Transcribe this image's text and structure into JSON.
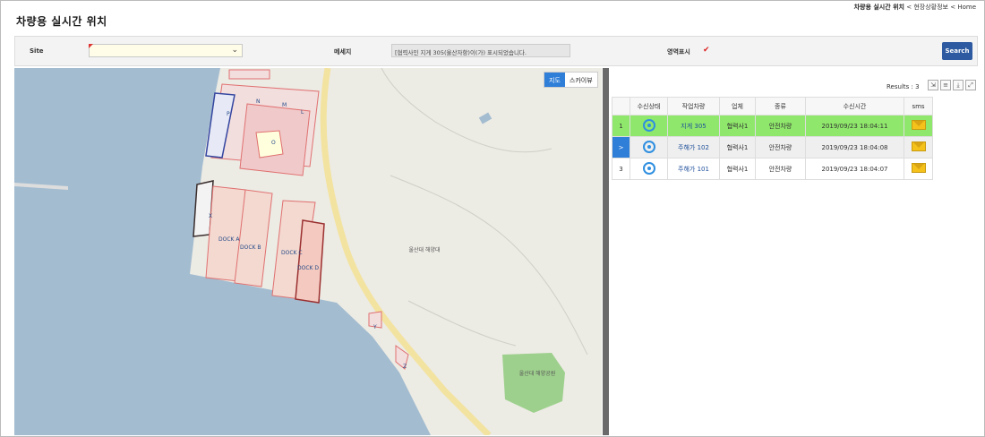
{
  "breadcrumb": {
    "current": "차량용 실시간 위치",
    "parent": "현장상황정보",
    "home": "Home",
    "sep": "<"
  },
  "page_title": "차량용 실시간 위치",
  "filter": {
    "site_label": "Site",
    "site_value": "",
    "message_label": "메세지",
    "message_value": "[협력사인 지게 305(울산자항)이(가) 표시되었습니다.",
    "area_label": "영역표시",
    "area_checked": true,
    "search_label": "Search"
  },
  "map": {
    "buttons": [
      "지도",
      "스카이뷰"
    ],
    "labels": [
      "P",
      "N",
      "M",
      "L",
      "O",
      "X",
      "DOCK A",
      "DOCK B",
      "DOCK C",
      "DOCK D",
      "Y",
      "Z"
    ],
    "place_1": "울산대 해양대",
    "place_2": "울산대 해양공원"
  },
  "grid": {
    "results_label": "Results : 3",
    "columns": [
      "",
      "수신상태",
      "작업차량",
      "업체",
      "종류",
      "수신시간",
      "sms"
    ],
    "rows": [
      {
        "no": "1",
        "vehicle": "지게 305",
        "company": "협력사1",
        "type": "안전차량",
        "time": "2019/09/23 18:04:11"
      },
      {
        "no": ">",
        "vehicle": "주해가 102",
        "company": "협력사1",
        "type": "안전차량",
        "time": "2019/09/23 18:04:08"
      },
      {
        "no": "3",
        "vehicle": "주해가 101",
        "company": "협력사1",
        "type": "안전차량",
        "time": "2019/09/23 18:04:07"
      }
    ]
  },
  "colors": {
    "search_button": "#2d5aa0",
    "selected_row": "#8fe86b",
    "sea": "#a3bcd0"
  }
}
